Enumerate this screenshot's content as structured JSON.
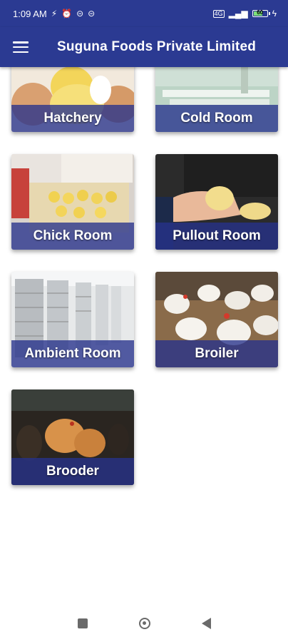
{
  "status_bar": {
    "time": "1:09 AM",
    "left_icons": [
      "vpn-icon",
      "alarm-icon",
      "data-icon",
      "data-icon"
    ],
    "network": "4G",
    "battery_level": "60"
  },
  "app_bar": {
    "title": "Suguna Foods Private Limited",
    "menu_icon": "menu-icon"
  },
  "cards": [
    {
      "label": "Hatchery"
    },
    {
      "label": "Cold Room"
    },
    {
      "label": "Chick Room"
    },
    {
      "label": "Pullout Room"
    },
    {
      "label": "Ambient Room"
    },
    {
      "label": "Broiler"
    },
    {
      "label": "Brooder"
    }
  ],
  "nav_bar": {
    "recents_icon": "square-icon",
    "home_icon": "circle-icon",
    "back_icon": "triangle-back-icon"
  }
}
